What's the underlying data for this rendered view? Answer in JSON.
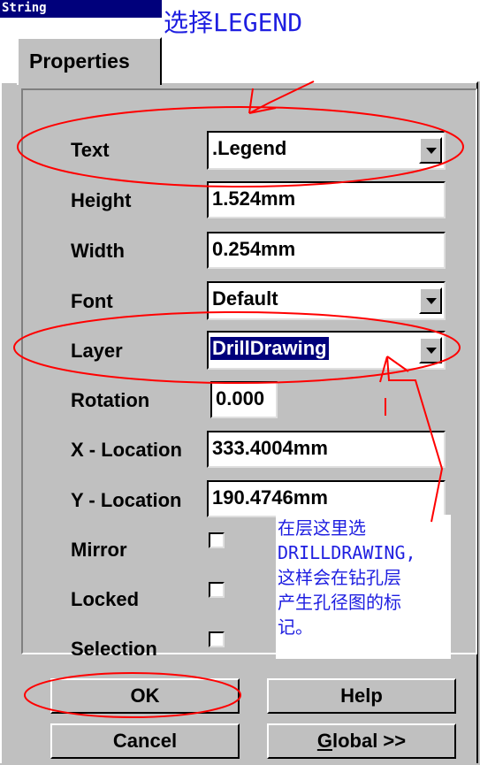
{
  "window": {
    "title": "String"
  },
  "annotations": {
    "top_note": "选择LEGEND",
    "side_note_lines": [
      "在层这里选",
      "DRILLDRAWING,",
      "这样会在钻孔层",
      "产生孔径图的标",
      "记。"
    ],
    "color": "#ff0000",
    "text_color": "#1e1ee0"
  },
  "tab": {
    "label": "Properties"
  },
  "fields": {
    "text": {
      "label": "Text",
      "value": ".Legend"
    },
    "height": {
      "label": "Height",
      "value": "1.524mm"
    },
    "width": {
      "label": "Width",
      "value": "0.254mm"
    },
    "font": {
      "label": "Font",
      "value": "Default"
    },
    "layer": {
      "label": "Layer",
      "value": "DrillDrawing"
    },
    "rotation": {
      "label": "Rotation",
      "value": "0.000"
    },
    "x_location": {
      "label": "X - Location",
      "value": "333.4004mm"
    },
    "y_location": {
      "label": "Y - Location",
      "value": "190.4746mm"
    }
  },
  "checkboxes": {
    "mirror": {
      "label": "Mirror",
      "checked": false
    },
    "locked": {
      "label": "Locked",
      "checked": false
    },
    "selection": {
      "label": "Selection",
      "checked": false
    }
  },
  "buttons": {
    "ok": "OK",
    "help": "Help",
    "cancel": "Cancel",
    "global_prefix": "G",
    "global_rest": "lobal >>"
  },
  "icons": {
    "dropdown": "chevron-down-icon",
    "checkbox": "checkbox"
  }
}
